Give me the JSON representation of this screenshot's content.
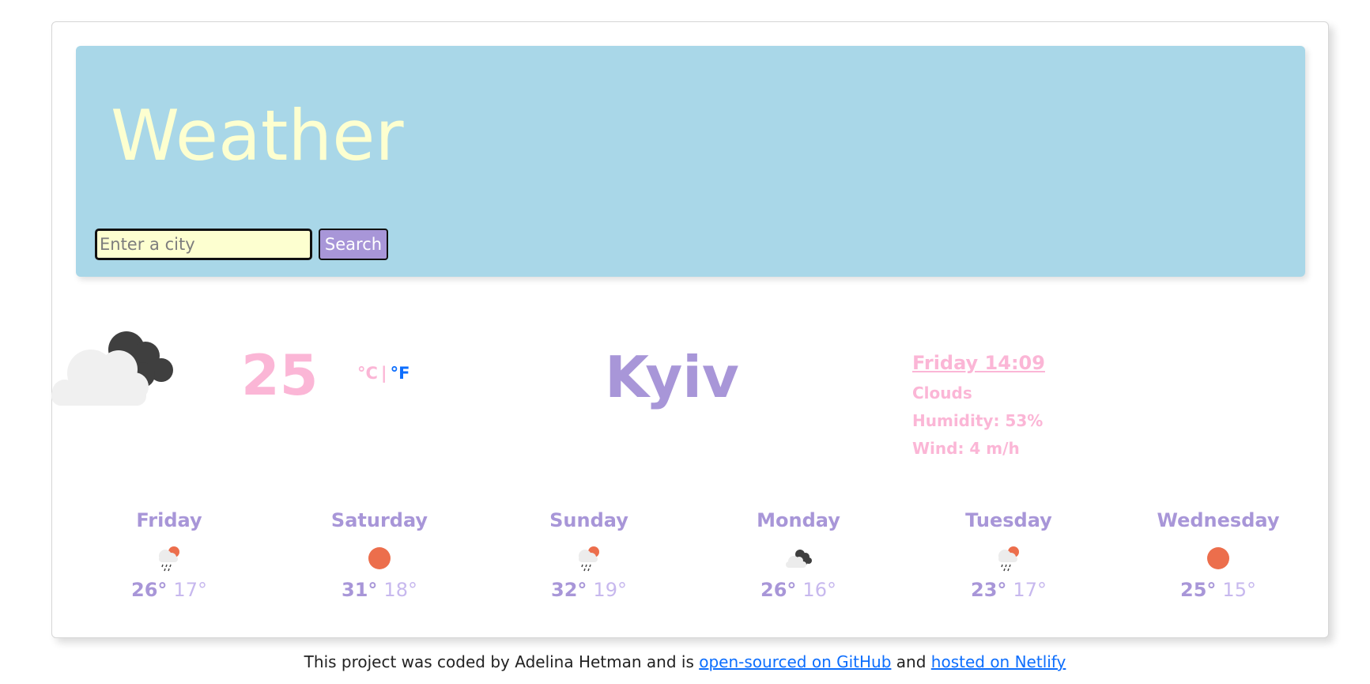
{
  "header": {
    "title": "Weather",
    "search_placeholder": "Enter a city",
    "search_value": "",
    "search_button": "Search"
  },
  "current": {
    "icon": "clouds-icon",
    "temperature": "25",
    "unit_celsius": "°C",
    "unit_separator": "|",
    "unit_fahrenheit": "°F",
    "city": "Kyiv",
    "datetime": "Friday 14:09",
    "description": "Clouds",
    "humidity": "Humidity: 53%",
    "wind": "Wind: 4 m/h"
  },
  "forecast": [
    {
      "day": "Friday",
      "icon": "rain-sun-icon",
      "max": "26°",
      "min": "17°"
    },
    {
      "day": "Saturday",
      "icon": "sun-icon",
      "max": "31°",
      "min": "18°"
    },
    {
      "day": "Sunday",
      "icon": "rain-sun-icon",
      "max": "32°",
      "min": "19°"
    },
    {
      "day": "Monday",
      "icon": "clouds-icon",
      "max": "26°",
      "min": "16°"
    },
    {
      "day": "Tuesday",
      "icon": "rain-sun-icon",
      "max": "23°",
      "min": "17°"
    },
    {
      "day": "Wednesday",
      "icon": "sun-icon",
      "max": "25°",
      "min": "15°"
    }
  ],
  "footer": {
    "text_before": "This project was coded by Adelina Hetman and is ",
    "link_github": "open-sourced on GitHub",
    "text_middle": " and ",
    "link_netlify": "hosted on Netlify"
  },
  "colors": {
    "header_bg": "#a9d7e8",
    "title": "#fdffd0",
    "accent_purple": "#a896d8",
    "accent_pink": "#fbb6d6",
    "link_blue": "#0d6efd",
    "sun": "#ec6e4c"
  }
}
